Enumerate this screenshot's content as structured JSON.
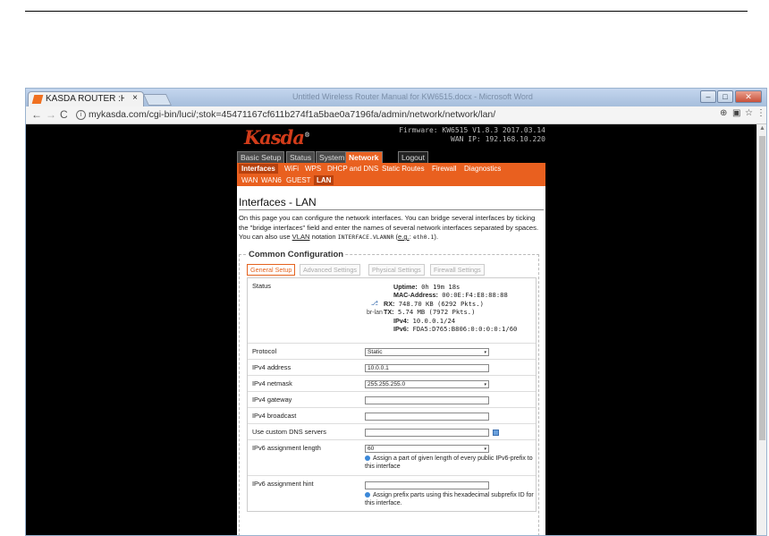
{
  "browser": {
    "tab_title": "KASDA ROUTER :Home",
    "tab_close": "×",
    "window_title": "Untitled Wireless Router Manual for KW6515.docx - Microsoft Word",
    "min_glyph": "–",
    "max_glyph": "□",
    "close_glyph": "✕",
    "back_glyph": "←",
    "forward_glyph": "→",
    "reload_glyph": "C",
    "info_glyph": "i",
    "url": "mykasda.com/cgi-bin/luci/;stok=45471167cf611b274f1a5bae0a7196fa/admin/network/network/lan/",
    "zoom_glyph": "⊕",
    "ext_glyph": "▣",
    "star_glyph": "☆",
    "menu_glyph": "⋮"
  },
  "router": {
    "logo": "Kasda",
    "logo_mark": "®",
    "firmware": "Firmware: KW6515 V1.8.3 2017.03.14",
    "wan_ip": "WAN IP: 192.168.10.220",
    "top_menu": [
      "Basic Setup",
      "Status",
      "System",
      "Network",
      "Logout"
    ],
    "sub_menu": [
      "Interfaces",
      "WiFi",
      "WPS",
      "DHCP and DNS",
      "Static Routes",
      "Firewall",
      "Diagnostics"
    ],
    "iface_menu": [
      "WAN",
      "WAN6",
      "GUEST",
      "LAN"
    ],
    "page_title": "Interfaces - LAN",
    "desc_part1": "On this page you can configure the network interfaces. You can bridge several interfaces by ticking the \"bridge interfaces\" field and enter the names of several network interfaces separated by spaces. You can also use ",
    "desc_vlan": "VLAN",
    "desc_part2": " notation ",
    "desc_notation": "INTERFACE.VLANNR",
    "desc_part3": " (",
    "desc_eg": "e.g.",
    "desc_part4": ": ",
    "desc_example": "eth0.1",
    "desc_part5": ").",
    "section_title": "Common Configuration",
    "config_tabs": [
      "General Setup",
      "Advanced Settings",
      "Physical Settings",
      "Firewall Settings"
    ],
    "status": {
      "label": "Status",
      "icon_glyph": "⎇",
      "iface": "br-lan",
      "uptime_k": "Uptime:",
      "uptime_v": " 0h 19m 18s",
      "mac_k": "MAC-Address:",
      "mac_v": " 00:0E:F4:E8:88:88",
      "rx_k": "RX:",
      "rx_v": " 748.70 KB (6292 Pkts.)",
      "tx_k": "TX:",
      "tx_v": " 5.74 MB (7972 Pkts.)",
      "ipv4_k": "IPv4:",
      "ipv4_v": " 10.0.0.1/24",
      "ipv6_k": "IPv6:",
      "ipv6_v": " FDA5:D765:B806:0:0:0:0:1/60"
    },
    "fields": {
      "protocol_label": "Protocol",
      "protocol_value": "Static",
      "ipv4_address_label": "IPv4 address",
      "ipv4_address_value": "10.0.0.1",
      "ipv4_netmask_label": "IPv4 netmask",
      "ipv4_netmask_value": "255.255.255.0",
      "ipv4_gateway_label": "IPv4 gateway",
      "ipv4_gateway_value": "",
      "ipv4_broadcast_label": "IPv4 broadcast",
      "ipv4_broadcast_value": "",
      "dns_label": "Use custom DNS servers",
      "dns_value": "",
      "ipv6_len_label": "IPv6 assignment length",
      "ipv6_len_value": "60",
      "ipv6_len_hint": "Assign a part of given length of every public IPv6-prefix to this interface",
      "ipv6_hint_label": "IPv6 assignment hint",
      "ipv6_hint_value": "",
      "ipv6_hint_hint": "Assign prefix parts using this hexadecimal subprefix ID for this interface."
    },
    "caret": "▾"
  },
  "colors": {
    "accent": "#e9601f",
    "accent_dark": "#b7410e",
    "logo": "#d23c1a",
    "page_bg": "#000000"
  }
}
